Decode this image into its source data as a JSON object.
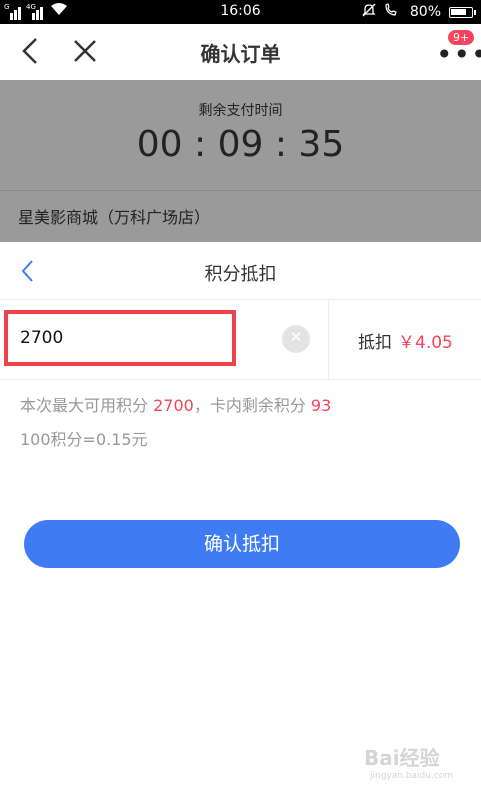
{
  "status_bar": {
    "time": "16:06",
    "battery": "80%",
    "battery_level": 0.8,
    "sim1": "G",
    "sim2": "4G"
  },
  "nav": {
    "title": "确认订单",
    "more_badge": "9+"
  },
  "order": {
    "timer_label": "剩余支付时间",
    "timer_value": "00 : 09 : 35",
    "cinema": "星美影商城（万科广场店）"
  },
  "sheet": {
    "title": "积分抵扣",
    "points_input": "2700",
    "deduct_label": "抵扣",
    "deduct_amount": "￥4.05",
    "info": {
      "prefix": "本次最大可用积分 ",
      "max_points": "2700",
      "middle": "，卡内剩余积分 ",
      "remaining_points": "93"
    },
    "rate": "100积分=0.15元",
    "confirm_label": "确认抵扣"
  },
  "watermark": {
    "text": "Bai经验",
    "sub": "jingyan.baidu.com"
  },
  "colors": {
    "accent_blue": "#3f7cf3",
    "accent_red": "#f5445b",
    "highlight_border": "#f0424a"
  }
}
